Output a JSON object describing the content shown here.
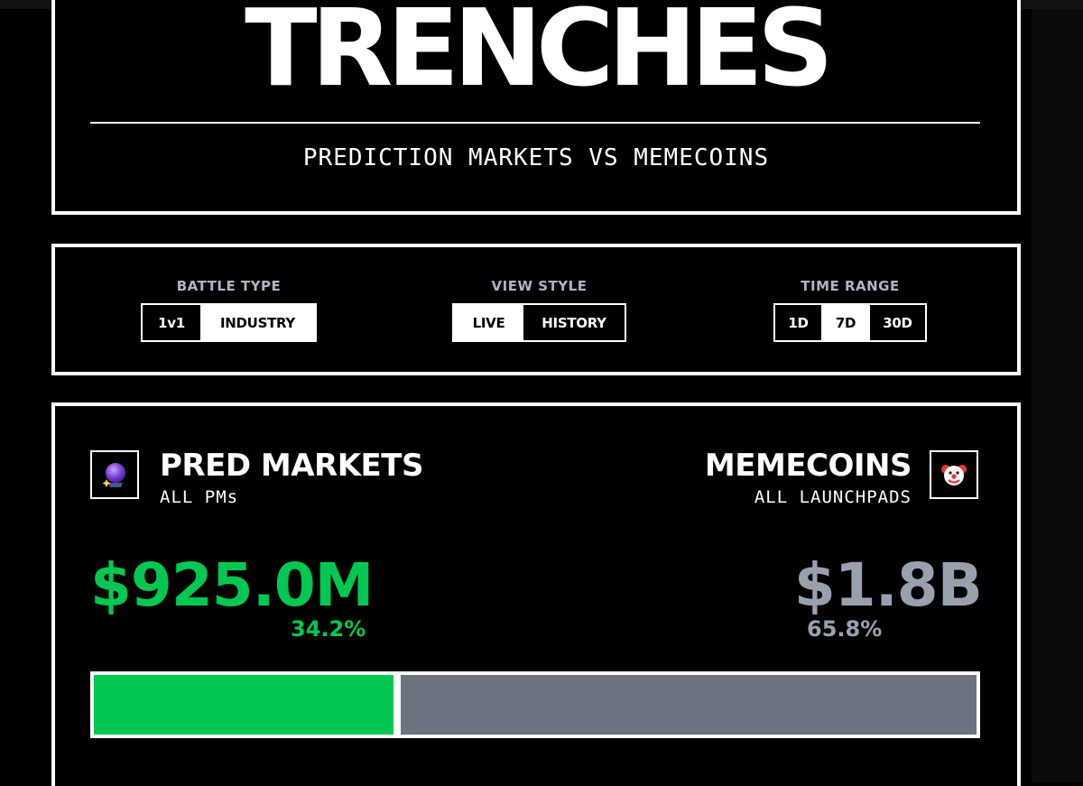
{
  "header": {
    "title": "TRENCHES",
    "subtitle": "PREDICTION MARKETS VS MEMECOINS"
  },
  "controls": {
    "battle_type": {
      "label": "BATTLE TYPE",
      "options": [
        "1v1",
        "INDUSTRY"
      ],
      "selected": "INDUSTRY"
    },
    "view_style": {
      "label": "VIEW STYLE",
      "options": [
        "LIVE",
        "HISTORY"
      ],
      "selected": "LIVE"
    },
    "time_range": {
      "label": "TIME RANGE",
      "options": [
        "1D",
        "7D",
        "30D"
      ],
      "selected": "7D"
    }
  },
  "battle": {
    "left": {
      "name": "PRED MARKETS",
      "sub": "ALL PMs",
      "icon": "crystal-ball-icon",
      "value": "$925.0M",
      "pct": "34.2%",
      "share": 0.342,
      "color": "#00c853"
    },
    "right": {
      "name": "MEMECOINS",
      "sub": "ALL LAUNCHPADS",
      "icon": "clown-face-icon",
      "value": "$1.8B",
      "pct": "65.8%",
      "share": 0.658,
      "color": "#9aa1ae",
      "bar_color": "#6b7280"
    }
  }
}
